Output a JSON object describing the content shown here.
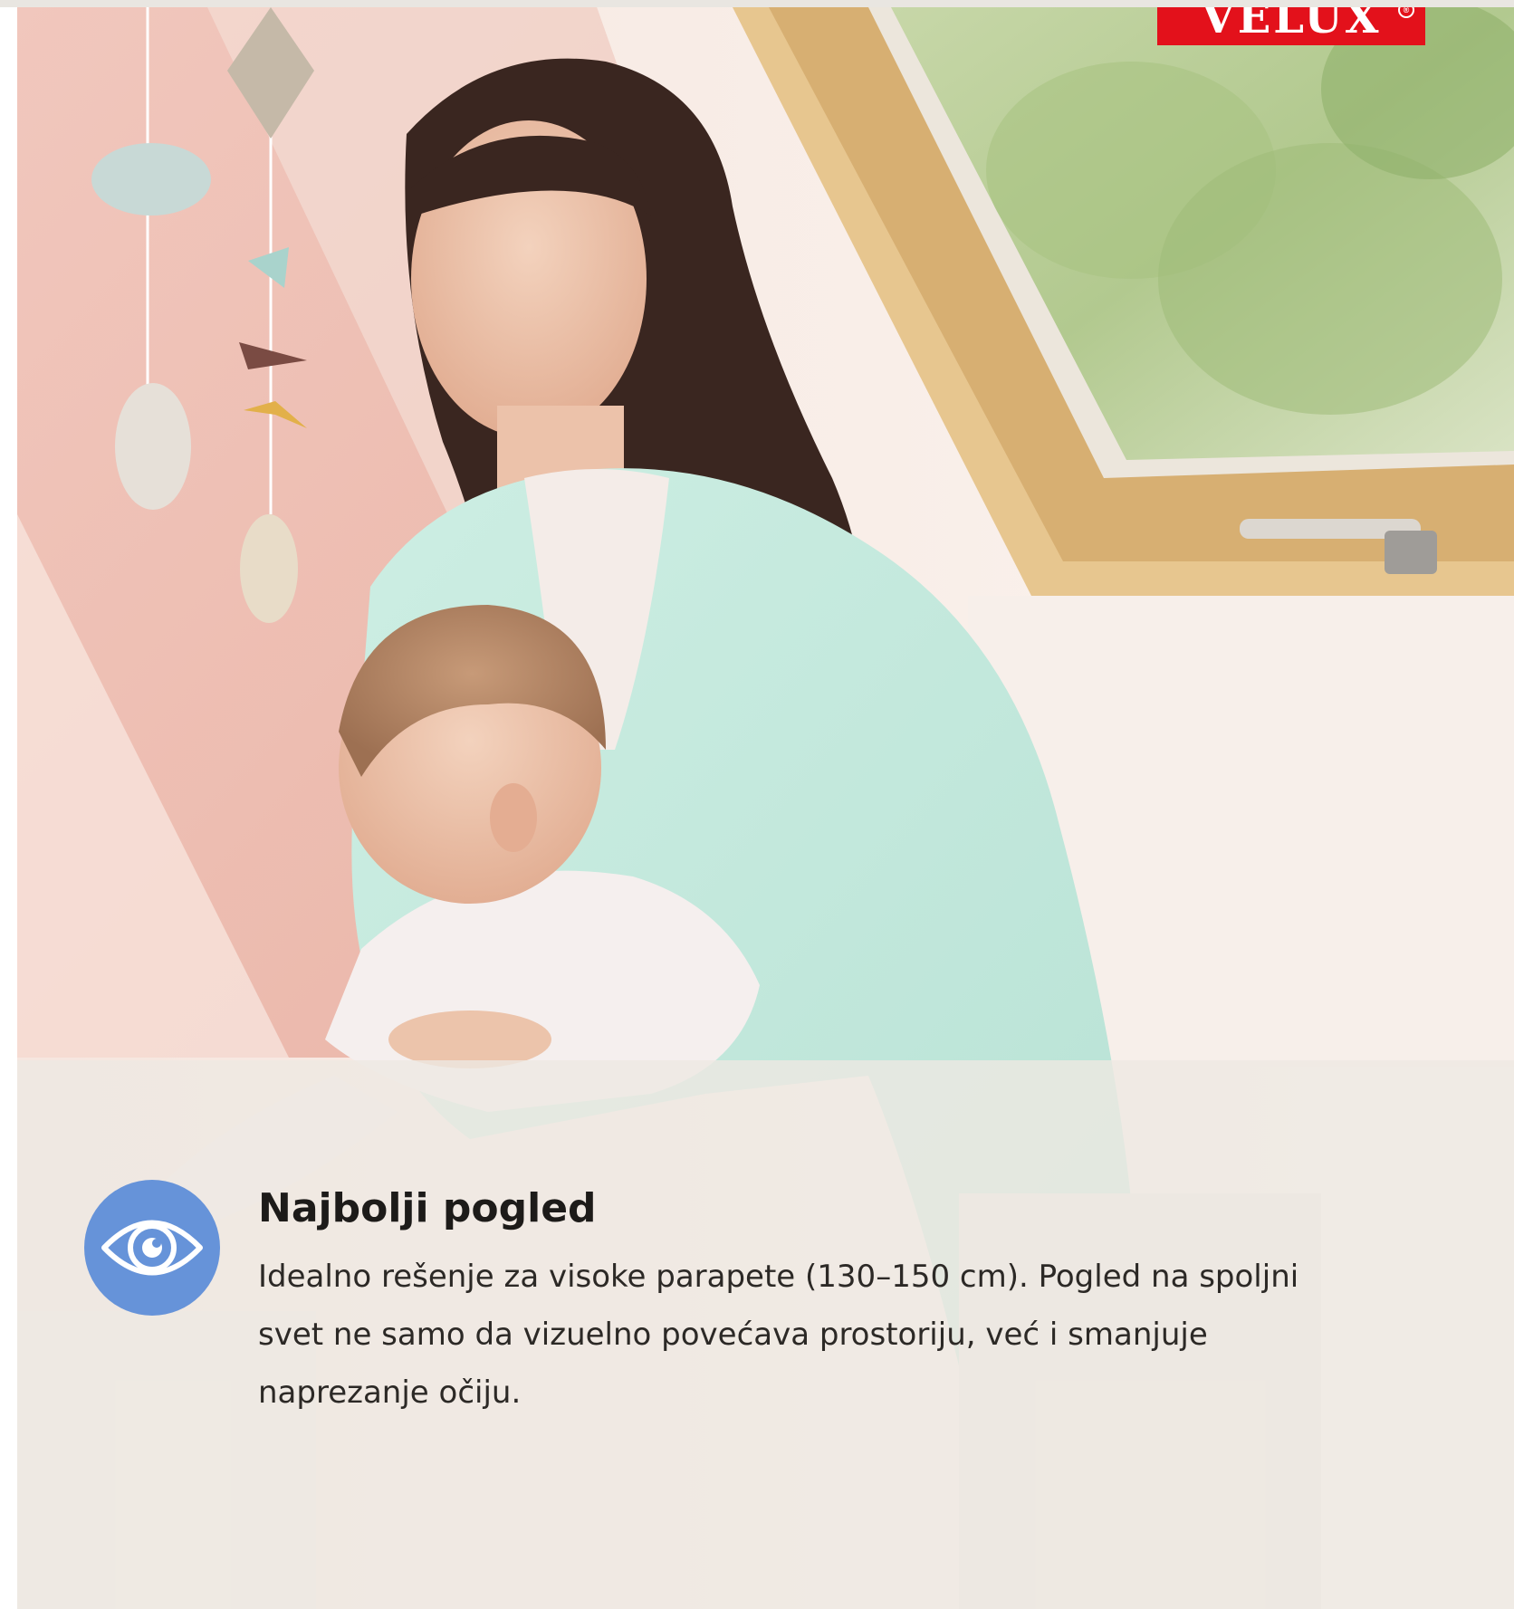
{
  "brand": {
    "logo_text": "VELUX",
    "registered_mark": "®",
    "logo_color": "#e3111b"
  },
  "hero": {
    "image_description_icon": "photo-woman-holding-baby-under-roof-window"
  },
  "feature": {
    "icon": "eye-icon",
    "icon_color": "#6693d9",
    "title": "Najbolji pogled",
    "text": "Idealno rešenje za visoke parapete (130–150 cm). Pogled na spoljni svet ne samo da vizuelno povećava prostoriju, već i smanjuje naprezanje očiju."
  }
}
